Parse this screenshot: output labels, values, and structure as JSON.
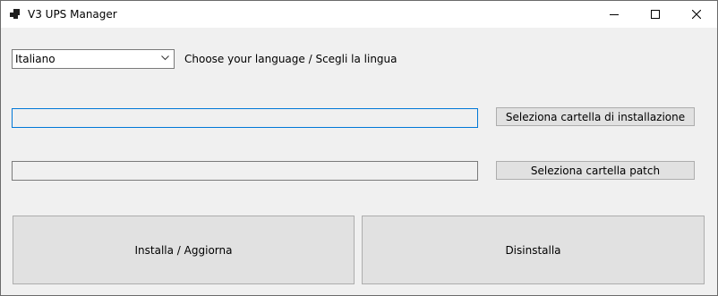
{
  "window": {
    "title": "V3 UPS Manager",
    "icon": "app-icon",
    "controls": [
      "minimize-icon",
      "maximize-icon",
      "close-icon"
    ]
  },
  "language": {
    "selected": "Italiano",
    "label": "Choose your language / Scegli la lingua"
  },
  "install_folder": {
    "value": "",
    "button_label": "Seleziona cartella di installazione"
  },
  "patch_folder": {
    "value": "",
    "button_label": "Seleziona cartella patch"
  },
  "actions": {
    "install_label": "Installa / Aggiorna",
    "uninstall_label": "Disinstalla"
  },
  "colors": {
    "focus_border": "#0078d7",
    "button_face": "#e1e1e1",
    "window_bg": "#f0f0f0"
  }
}
